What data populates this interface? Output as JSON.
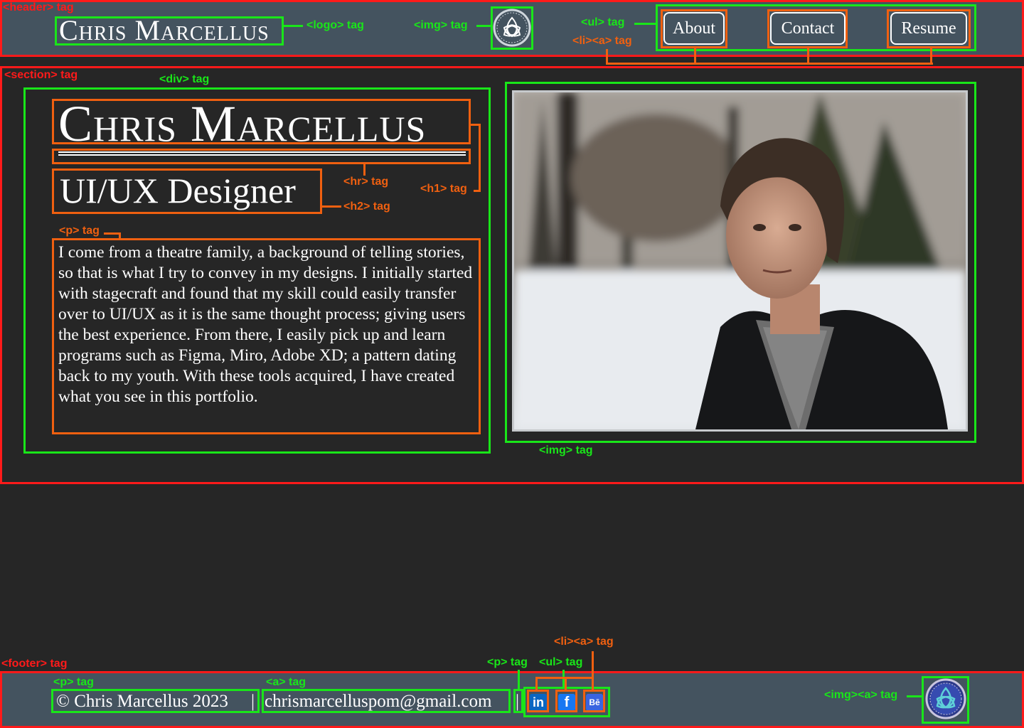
{
  "annotations": {
    "header": "<header> tag",
    "logo": "<logo> tag",
    "header_img": "<img> tag",
    "ul": "<ul> tag",
    "li_a": "<li><a> tag",
    "section": "<section> tag",
    "div": "<div> tag",
    "hr": "<hr> tag",
    "h1": "<h1> tag",
    "h2": "<h2> tag",
    "p": "<p> tag",
    "img": "<img> tag",
    "footer": "<footer> tag",
    "footer_p": "<p> tag",
    "footer_a": "<a> tag",
    "footer_p2": "<p> tag",
    "footer_ul": "<ul> tag",
    "footer_li_a": "<li><a> tag",
    "footer_img_a": "<img><a> tag"
  },
  "header": {
    "logo_text": "Chris Marcellus",
    "nav": [
      "About",
      "Contact",
      "Resume"
    ]
  },
  "main": {
    "title": "Chris Marcellus",
    "subtitle": "UI/UX Designer",
    "bio": "I come from a theatre family, a background of telling stories, so that is what I try to convey in my designs. I initially started with stagecraft and found that my skill could easily transfer over to UI/UX as it is the same thought process; giving users the best experience. From there, I easily pick up and learn programs such as Figma, Miro, Adobe XD; a pattern dating back to my youth. With these tools acquired, I have created what you see in this portfolio."
  },
  "footer": {
    "copyright": "© Chris Marcellus 2023",
    "separator": "|",
    "email": "chrismarcelluspom@gmail.com",
    "social": [
      {
        "icon": "linkedin-icon",
        "label": "in",
        "color": "#0a66c2"
      },
      {
        "icon": "facebook-icon",
        "label": "f",
        "color": "#1877f2"
      },
      {
        "icon": "behance-icon",
        "label": "Bē",
        "color": "#3a64e0"
      }
    ]
  }
}
